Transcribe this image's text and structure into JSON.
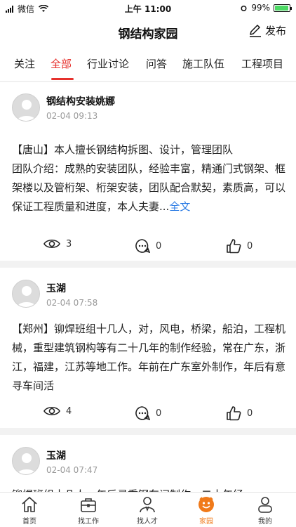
{
  "status_bar": {
    "carrier": "微信",
    "time": "上午 11:00",
    "battery": "99%"
  },
  "nav": {
    "title": "钢结构家园",
    "publish_label": "发布"
  },
  "tabs": [
    {
      "label": "关注",
      "active": false
    },
    {
      "label": "全部",
      "active": true
    },
    {
      "label": "行业讨论",
      "active": false
    },
    {
      "label": "问答",
      "active": false
    },
    {
      "label": "施工队伍",
      "active": false
    },
    {
      "label": "工程项目",
      "active": false
    }
  ],
  "posts": [
    {
      "author": "钢结构安装姚娜",
      "time": "02-04 09:13",
      "text": "【唐山】本人擅长钢结构拆图、设计，管理团队\n团队介绍：成熟的安装团队，经验丰富，精通门式钢架、框架楼以及管桁架、桁架安装，团队配合默契，素质高，可以保证工程质量和进度，本人夫妻...",
      "more": "全文",
      "views": "3",
      "comments": "0",
      "likes": "0"
    },
    {
      "author": "玉湖",
      "time": "02-04 07:58",
      "text": "【郑州】铆焊班组十几人，对，风电，桥梁，船泊，工程机械，重型建筑钢构等有二十几年的制作经验，常在广东，浙江，福建，江苏等地工作。年前在广东室外制作，年后有意寻车间活",
      "views": "4",
      "comments": "0",
      "likes": "0"
    },
    {
      "author": "玉湖",
      "time": "02-04 07:47",
      "text": "铆焊班组十几人，年后寻重钢车间制作，二十年经"
    }
  ],
  "tabbar": [
    {
      "label": "首页",
      "icon": "home-icon"
    },
    {
      "label": "找工作",
      "icon": "briefcase-icon"
    },
    {
      "label": "找人才",
      "icon": "person-search-icon"
    },
    {
      "label": "家园",
      "icon": "community-icon",
      "active": true
    },
    {
      "label": "我的",
      "icon": "profile-icon"
    }
  ],
  "colors": {
    "accent": "#e6312d",
    "link": "#2b7be4",
    "tab_active": "#f07a1a"
  }
}
